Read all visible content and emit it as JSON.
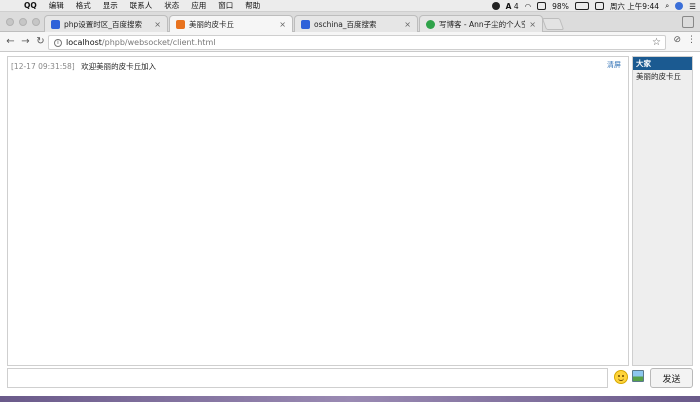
{
  "menubar": {
    "apple": "",
    "items": [
      "QQ",
      "编辑",
      "格式",
      "显示",
      "联系人",
      "状态",
      "应用",
      "窗口",
      "帮助"
    ],
    "battery": "98%",
    "clock": "周六 上午9:44",
    "ime": "A",
    "badge": "4"
  },
  "tabs": [
    {
      "title": "php设置时区_百度搜索",
      "favicon_color": "#2f62d9"
    },
    {
      "title": "美丽的皮卡丘",
      "favicon_color": "#e8731f"
    },
    {
      "title": "oschina_百度搜索",
      "favicon_color": "#2f62d9"
    },
    {
      "title": "写博客 - Ann子尘的个人空间 - ",
      "favicon_color": "#2fa34a"
    }
  ],
  "address": {
    "host": "localhost",
    "path": "/phpb/websocket/client.html"
  },
  "chat": {
    "clear_label": "清屏",
    "messages": [
      {
        "time": "[12-17 09:31:58]",
        "text": "欢迎美丽的皮卡丘加入"
      }
    ]
  },
  "users": {
    "items": [
      "大家",
      "美丽的皮卡丘"
    ]
  },
  "composer": {
    "value": "",
    "send_label": "发送"
  }
}
